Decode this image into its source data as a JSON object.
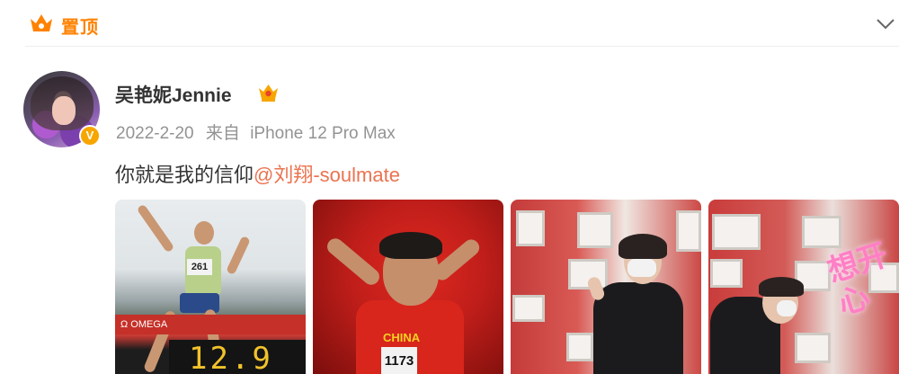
{
  "pinned": {
    "label": "置顶",
    "icon": "crown-icon",
    "expand_icon": "chevron-down-icon"
  },
  "author": {
    "name": "吴艳妮Jennie",
    "verified_badge": "V",
    "member_badge_icon": "crown-icon"
  },
  "post": {
    "date": "2022-2-20",
    "source_prefix": "来自",
    "source": "iPhone 12 Pro Max",
    "text": "你就是我的信仰",
    "mention": "@刘翔-soulmate"
  },
  "photos": [
    {
      "bib": "261",
      "band_text": "Ω OMEGA",
      "scoreboard": "12.9"
    },
    {
      "jersey_text": "CHINA",
      "bib": "1173"
    },
    {},
    {
      "neon_text": "想开心"
    }
  ],
  "colors": {
    "brand_orange": "#ff8200",
    "mention": "#eb7350",
    "meta_gray": "#939393"
  }
}
